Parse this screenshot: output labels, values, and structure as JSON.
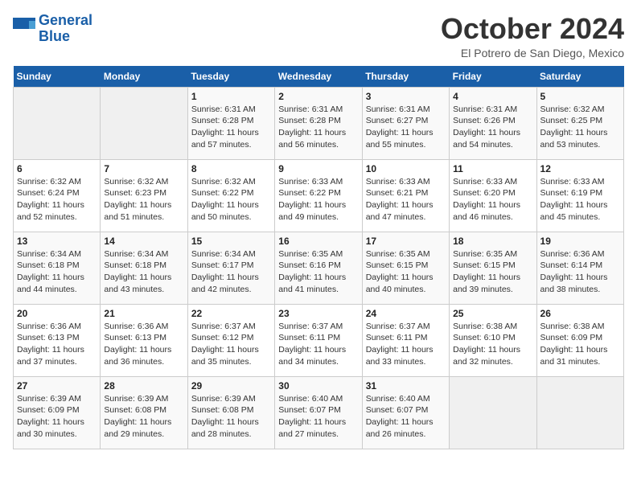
{
  "header": {
    "logo_line1": "General",
    "logo_line2": "Blue",
    "month_title": "October 2024",
    "subtitle": "El Potrero de San Diego, Mexico"
  },
  "weekdays": [
    "Sunday",
    "Monday",
    "Tuesday",
    "Wednesday",
    "Thursday",
    "Friday",
    "Saturday"
  ],
  "weeks": [
    [
      {
        "day": "",
        "info": ""
      },
      {
        "day": "",
        "info": ""
      },
      {
        "day": "1",
        "info": "Sunrise: 6:31 AM\nSunset: 6:28 PM\nDaylight: 11 hours and 57 minutes."
      },
      {
        "day": "2",
        "info": "Sunrise: 6:31 AM\nSunset: 6:28 PM\nDaylight: 11 hours and 56 minutes."
      },
      {
        "day": "3",
        "info": "Sunrise: 6:31 AM\nSunset: 6:27 PM\nDaylight: 11 hours and 55 minutes."
      },
      {
        "day": "4",
        "info": "Sunrise: 6:31 AM\nSunset: 6:26 PM\nDaylight: 11 hours and 54 minutes."
      },
      {
        "day": "5",
        "info": "Sunrise: 6:32 AM\nSunset: 6:25 PM\nDaylight: 11 hours and 53 minutes."
      }
    ],
    [
      {
        "day": "6",
        "info": "Sunrise: 6:32 AM\nSunset: 6:24 PM\nDaylight: 11 hours and 52 minutes."
      },
      {
        "day": "7",
        "info": "Sunrise: 6:32 AM\nSunset: 6:23 PM\nDaylight: 11 hours and 51 minutes."
      },
      {
        "day": "8",
        "info": "Sunrise: 6:32 AM\nSunset: 6:22 PM\nDaylight: 11 hours and 50 minutes."
      },
      {
        "day": "9",
        "info": "Sunrise: 6:33 AM\nSunset: 6:22 PM\nDaylight: 11 hours and 49 minutes."
      },
      {
        "day": "10",
        "info": "Sunrise: 6:33 AM\nSunset: 6:21 PM\nDaylight: 11 hours and 47 minutes."
      },
      {
        "day": "11",
        "info": "Sunrise: 6:33 AM\nSunset: 6:20 PM\nDaylight: 11 hours and 46 minutes."
      },
      {
        "day": "12",
        "info": "Sunrise: 6:33 AM\nSunset: 6:19 PM\nDaylight: 11 hours and 45 minutes."
      }
    ],
    [
      {
        "day": "13",
        "info": "Sunrise: 6:34 AM\nSunset: 6:18 PM\nDaylight: 11 hours and 44 minutes."
      },
      {
        "day": "14",
        "info": "Sunrise: 6:34 AM\nSunset: 6:18 PM\nDaylight: 11 hours and 43 minutes."
      },
      {
        "day": "15",
        "info": "Sunrise: 6:34 AM\nSunset: 6:17 PM\nDaylight: 11 hours and 42 minutes."
      },
      {
        "day": "16",
        "info": "Sunrise: 6:35 AM\nSunset: 6:16 PM\nDaylight: 11 hours and 41 minutes."
      },
      {
        "day": "17",
        "info": "Sunrise: 6:35 AM\nSunset: 6:15 PM\nDaylight: 11 hours and 40 minutes."
      },
      {
        "day": "18",
        "info": "Sunrise: 6:35 AM\nSunset: 6:15 PM\nDaylight: 11 hours and 39 minutes."
      },
      {
        "day": "19",
        "info": "Sunrise: 6:36 AM\nSunset: 6:14 PM\nDaylight: 11 hours and 38 minutes."
      }
    ],
    [
      {
        "day": "20",
        "info": "Sunrise: 6:36 AM\nSunset: 6:13 PM\nDaylight: 11 hours and 37 minutes."
      },
      {
        "day": "21",
        "info": "Sunrise: 6:36 AM\nSunset: 6:13 PM\nDaylight: 11 hours and 36 minutes."
      },
      {
        "day": "22",
        "info": "Sunrise: 6:37 AM\nSunset: 6:12 PM\nDaylight: 11 hours and 35 minutes."
      },
      {
        "day": "23",
        "info": "Sunrise: 6:37 AM\nSunset: 6:11 PM\nDaylight: 11 hours and 34 minutes."
      },
      {
        "day": "24",
        "info": "Sunrise: 6:37 AM\nSunset: 6:11 PM\nDaylight: 11 hours and 33 minutes."
      },
      {
        "day": "25",
        "info": "Sunrise: 6:38 AM\nSunset: 6:10 PM\nDaylight: 11 hours and 32 minutes."
      },
      {
        "day": "26",
        "info": "Sunrise: 6:38 AM\nSunset: 6:09 PM\nDaylight: 11 hours and 31 minutes."
      }
    ],
    [
      {
        "day": "27",
        "info": "Sunrise: 6:39 AM\nSunset: 6:09 PM\nDaylight: 11 hours and 30 minutes."
      },
      {
        "day": "28",
        "info": "Sunrise: 6:39 AM\nSunset: 6:08 PM\nDaylight: 11 hours and 29 minutes."
      },
      {
        "day": "29",
        "info": "Sunrise: 6:39 AM\nSunset: 6:08 PM\nDaylight: 11 hours and 28 minutes."
      },
      {
        "day": "30",
        "info": "Sunrise: 6:40 AM\nSunset: 6:07 PM\nDaylight: 11 hours and 27 minutes."
      },
      {
        "day": "31",
        "info": "Sunrise: 6:40 AM\nSunset: 6:07 PM\nDaylight: 11 hours and 26 minutes."
      },
      {
        "day": "",
        "info": ""
      },
      {
        "day": "",
        "info": ""
      }
    ]
  ]
}
